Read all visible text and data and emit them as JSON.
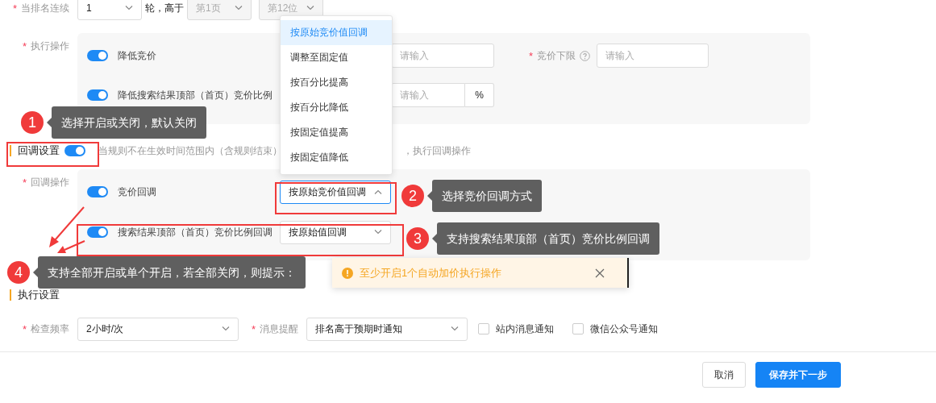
{
  "rank_rule": {
    "label": "当排名连续",
    "required_mark": "*",
    "rounds_select": {
      "value": "1",
      "disabled": false
    },
    "connector": "轮，高于",
    "page_select": {
      "value": "第1页",
      "disabled": true
    },
    "position_select": {
      "value": "第12位",
      "disabled": true
    }
  },
  "execute_operations": {
    "label": "执行操作",
    "required_mark": "*",
    "items": [
      {
        "kind": "input",
        "label": "降低竞价",
        "on": true,
        "placeholder": "请输入",
        "limit": {
          "label": "竞价下限",
          "required_mark": "*",
          "placeholder": "请输入"
        }
      },
      {
        "kind": "percent",
        "label": "降低搜索结果顶部（首页）竞价比例",
        "on": true,
        "placeholder": "请输入",
        "unit": "%"
      }
    ]
  },
  "callback_settings": {
    "title": "回调设置",
    "on": true,
    "description_before": "当规则不在生效时间范围内（含规则结束）",
    "description_after": "，执行回调操作"
  },
  "callback_operations": {
    "label": "回调操作",
    "required_mark": "*",
    "items": [
      {
        "label": "竞价回调",
        "on": true,
        "select": {
          "value": "按原始竞价值回调",
          "open": true
        }
      },
      {
        "label": "搜索结果顶部（首页）竞价比例回调",
        "on": true,
        "select": {
          "value": "按原始值回调",
          "open": false
        }
      }
    ]
  },
  "callback_menu": {
    "options": [
      {
        "label": "按原始竞价值回调",
        "selected": true
      },
      {
        "label": "调整至固定值",
        "selected": false
      },
      {
        "label": "按百分比提高",
        "selected": false
      },
      {
        "label": "按百分比降低",
        "selected": false
      },
      {
        "label": "按固定值提高",
        "selected": false
      },
      {
        "label": "按固定值降低",
        "selected": false
      }
    ]
  },
  "execution_settings": {
    "title": "执行设置",
    "fields": [
      {
        "label": "检查频率",
        "required_mark": "*",
        "value": "2小时/次"
      },
      {
        "label": "消息提醒",
        "required_mark": "*",
        "value": "排名高于预期时通知"
      }
    ],
    "notify_options": [
      {
        "label": "站内消息通知",
        "checked": false
      },
      {
        "label": "微信公众号通知",
        "checked": false
      }
    ]
  },
  "toast": {
    "message": "至少开启1个自动加价执行操作"
  },
  "footer_buttons": [
    {
      "label": "取消",
      "kind": "default"
    },
    {
      "label": "保存并下一步",
      "kind": "primary"
    }
  ],
  "annotations": [
    {
      "number": "1",
      "text": "选择开启或关闭，默认关闭"
    },
    {
      "number": "2",
      "text": "选择竞价回调方式"
    },
    {
      "number": "3",
      "text": "支持搜索结果顶部（首页）竞价比例回调"
    },
    {
      "number": "4",
      "text": "支持全部开启或单个开启，若全部关闭，则提示："
    }
  ]
}
